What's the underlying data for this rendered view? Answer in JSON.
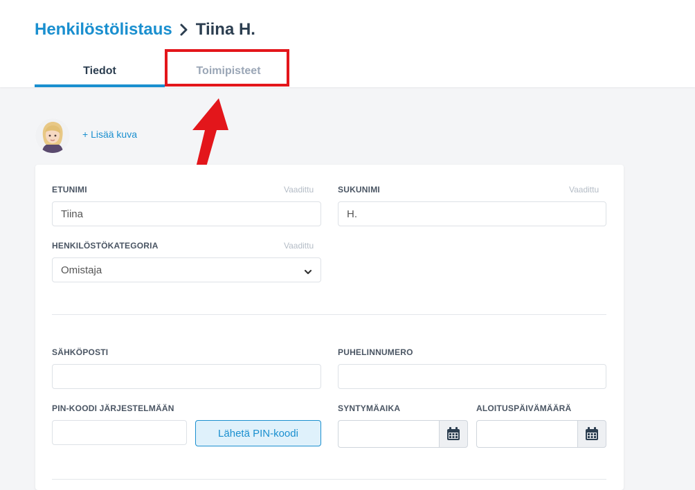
{
  "breadcrumb": {
    "parent": "Henkilöstölistaus",
    "current": "Tiina H."
  },
  "tabs": [
    {
      "label": "Tiedot"
    },
    {
      "label": "Toimipisteet"
    }
  ],
  "profile": {
    "add_photo": "+ Lisää kuva"
  },
  "form": {
    "required_text": "Vaadittu",
    "first_name": {
      "label": "ETUNIMI",
      "value": "Tiina"
    },
    "last_name": {
      "label": "SUKUNIMI",
      "value": "H."
    },
    "category": {
      "label": "HENKILÖSTÖKATEGORIA",
      "value": "Omistaja"
    },
    "email": {
      "label": "SÄHKÖPOSTI",
      "value": ""
    },
    "phone": {
      "label": "PUHELINNUMERO",
      "value": ""
    },
    "pin": {
      "label": "PIN-KOODI JÄRJESTELMÄÄN",
      "value": "",
      "send_button": "Lähetä PIN-koodi"
    },
    "birth_date": {
      "label": "SYNTYMÄAIKA",
      "value": ""
    },
    "start_date": {
      "label": "ALOITUSPÄIVÄMÄÄRÄ",
      "value": ""
    }
  },
  "colors": {
    "accent": "#1a8fcf",
    "annotation": "#e3161b",
    "title": "#2c3e50"
  },
  "icons": [
    "chevron-right-icon",
    "chevron-down-icon",
    "calendar-icon"
  ]
}
